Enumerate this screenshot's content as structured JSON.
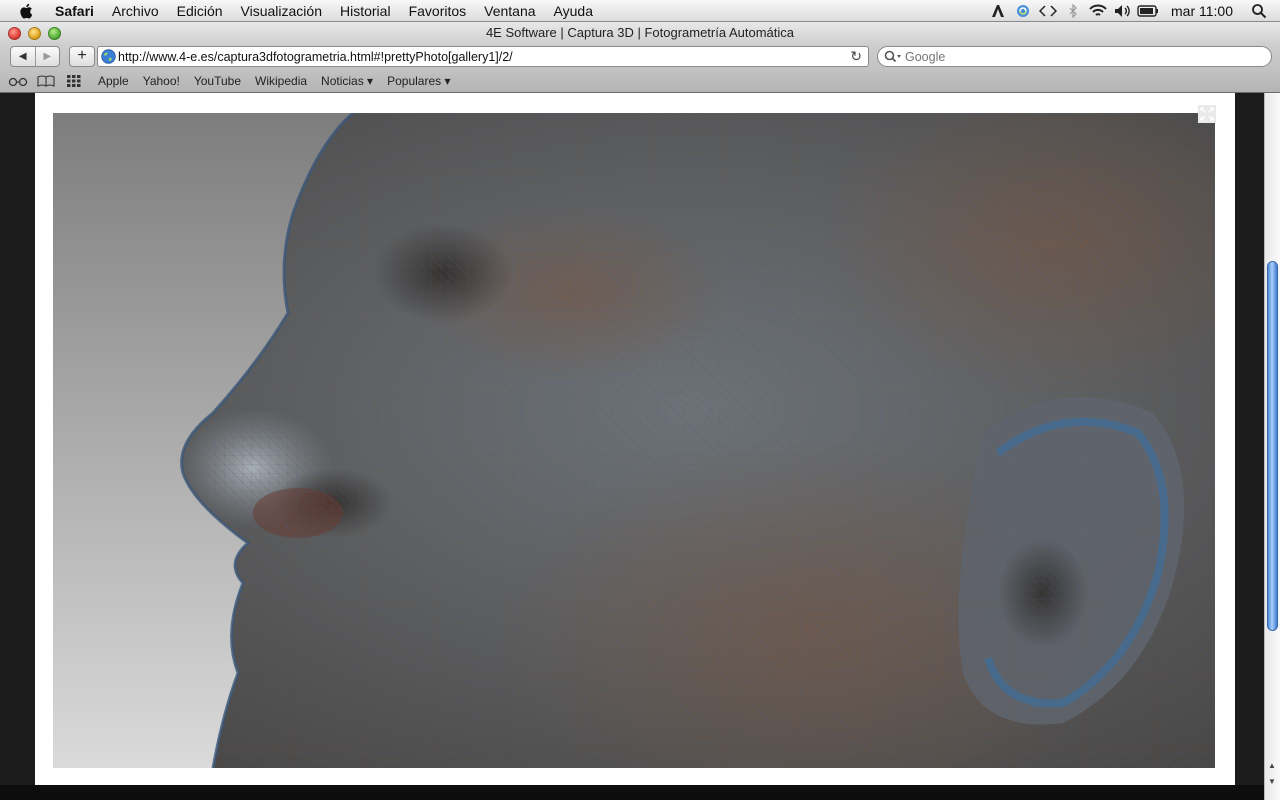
{
  "menubar": {
    "app_name": "Safari",
    "items": [
      "Archivo",
      "Edición",
      "Visualización",
      "Historial",
      "Favoritos",
      "Ventana",
      "Ayuda"
    ],
    "clock": "mar 11:00",
    "status_icons": [
      "adobe-icon",
      "sync-icon",
      "code-icon",
      "bluetooth-icon",
      "wifi-icon",
      "volume-icon",
      "battery-icon",
      "spotlight-icon"
    ]
  },
  "window": {
    "title": "4E Software | Captura 3D | Fotogrametría Automática"
  },
  "toolbar": {
    "url": "http://www.4-e.es/captura3dfotogrametria.html#!prettyPhoto[gallery1]/2/",
    "search_placeholder": "Google"
  },
  "bookmarks": {
    "items": [
      "Apple",
      "Yahoo!",
      "YouTube",
      "Wikipedia",
      "Noticias ▾",
      "Populares ▾"
    ]
  },
  "colors": {
    "scroll_thumb": "#5b95e0",
    "photo_bg_top": "#7d7d7d",
    "photo_bg_bottom": "#d9d9d9"
  }
}
